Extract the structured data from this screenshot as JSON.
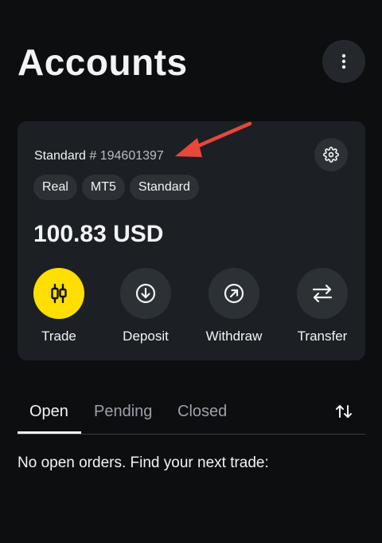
{
  "header": {
    "title": "Accounts",
    "menu_icon": "more-vertical-icon"
  },
  "account": {
    "type": "Standard",
    "number": "# 194601397",
    "settings_icon": "gear-icon",
    "tags": [
      "Real",
      "MT5",
      "Standard"
    ],
    "balance": "100.83 USD",
    "actions": [
      {
        "label": "Trade",
        "icon": "candlestick-icon",
        "accent": "#ffde02"
      },
      {
        "label": "Deposit",
        "icon": "arrow-down-circle-icon"
      },
      {
        "label": "Withdraw",
        "icon": "arrow-up-right-circle-icon"
      },
      {
        "label": "Transfer",
        "icon": "swap-arrows-icon"
      }
    ]
  },
  "tabs": {
    "items": [
      "Open",
      "Pending",
      "Closed"
    ],
    "active": "Open",
    "sort_icon": "sort-arrows-icon"
  },
  "orders": {
    "empty_message": "No open orders. Find your next trade:"
  },
  "annotation": {
    "arrow_color": "#e8473a"
  }
}
